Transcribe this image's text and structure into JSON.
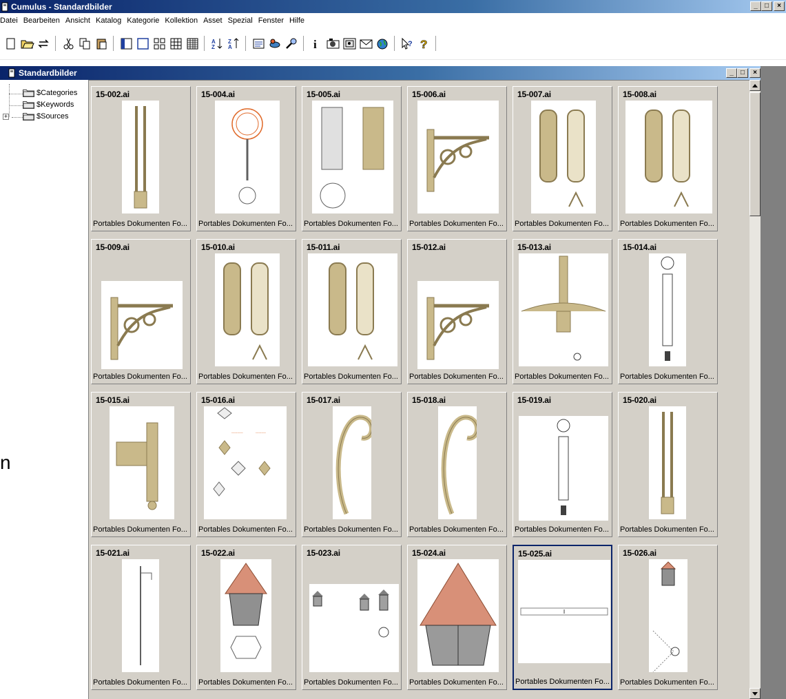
{
  "app": {
    "title": "Cumulus - Standardbilder",
    "window_buttons": [
      "_",
      "□",
      "×"
    ]
  },
  "menu": [
    "Datei",
    "Bearbeiten",
    "Ansicht",
    "Katalog",
    "Kategorie",
    "Kollektion",
    "Asset",
    "Spezial",
    "Fenster",
    "Hilfe"
  ],
  "toolbar": {
    "buttons": [
      "new-icon",
      "open-folder-icon",
      "swap-icon",
      "cut-icon",
      "copy-icon",
      "paste-icon",
      "preview-pane-icon",
      "single-view-icon",
      "thumb-view-icon",
      "small-thumb-view-icon",
      "list-view-icon",
      "sort-asc-icon",
      "sort-desc-icon",
      "record-view-icon",
      "connect-icon",
      "find-icon",
      "info-icon",
      "camera-icon",
      "preview-icon",
      "mail-icon",
      "web-icon",
      "context-help-icon",
      "help-icon"
    ]
  },
  "catalog_window": {
    "title": "Standardbilder",
    "window_buttons": [
      "_",
      "□",
      "×"
    ]
  },
  "tree": {
    "items": [
      {
        "label": "$Categories",
        "expandable": false
      },
      {
        "label": "$Keywords",
        "expandable": false
      },
      {
        "label": "$Sources",
        "expandable": true,
        "expander": "+"
      }
    ]
  },
  "assets": [
    {
      "name": "15-002.ai",
      "caption": "Portables Dokumenten Fo...",
      "thumb": "tall-pole-icon"
    },
    {
      "name": "15-004.ai",
      "caption": "Portables Dokumenten Fo...",
      "thumb": "lamp-drawing-icon"
    },
    {
      "name": "15-005.ai",
      "caption": "Portables Dokumenten Fo...",
      "thumb": "column-drawing-icon"
    },
    {
      "name": "15-006.ai",
      "caption": "Portables Dokumenten Fo...",
      "thumb": "ornate-bracket-icon"
    },
    {
      "name": "15-007.ai",
      "caption": "Portables Dokumenten Fo...",
      "thumb": "wall-plate-icon"
    },
    {
      "name": "15-008.ai",
      "caption": "Portables Dokumenten Fo...",
      "thumb": "wall-plate-icon"
    },
    {
      "name": "15-009.ai",
      "caption": "Portables Dokumenten Fo...",
      "thumb": "ornate-bracket-icon"
    },
    {
      "name": "15-010.ai",
      "caption": "Portables Dokumenten Fo...",
      "thumb": "wall-plate-icon"
    },
    {
      "name": "15-011.ai",
      "caption": "Portables Dokumenten Fo...",
      "thumb": "wall-plate-icon"
    },
    {
      "name": "15-012.ai",
      "caption": "Portables Dokumenten Fo...",
      "thumb": "ornate-bracket-icon"
    },
    {
      "name": "15-013.ai",
      "caption": "Portables Dokumenten Fo...",
      "thumb": "chandelier-icon"
    },
    {
      "name": "15-014.ai",
      "caption": "Portables Dokumenten Fo...",
      "thumb": "technical-drawing-icon"
    },
    {
      "name": "15-015.ai",
      "caption": "Portables Dokumenten Fo...",
      "thumb": "side-bracket-icon"
    },
    {
      "name": "15-016.ai",
      "caption": "Portables Dokumenten Fo...",
      "thumb": "parts-sheet-icon"
    },
    {
      "name": "15-017.ai",
      "caption": "Portables Dokumenten Fo...",
      "thumb": "hook-arm-icon"
    },
    {
      "name": "15-018.ai",
      "caption": "Portables Dokumenten Fo...",
      "thumb": "hook-arm-icon"
    },
    {
      "name": "15-019.ai",
      "caption": "Portables Dokumenten Fo...",
      "thumb": "technical-drawing-icon"
    },
    {
      "name": "15-020.ai",
      "caption": "Portables Dokumenten Fo...",
      "thumb": "tall-pole-icon"
    },
    {
      "name": "15-021.ai",
      "caption": "Portables Dokumenten Fo...",
      "thumb": "thin-pole-icon"
    },
    {
      "name": "15-022.ai",
      "caption": "Portables Dokumenten Fo...",
      "thumb": "lantern-icon"
    },
    {
      "name": "15-023.ai",
      "caption": "Portables Dokumenten Fo...",
      "thumb": "small-lanterns-icon"
    },
    {
      "name": "15-024.ai",
      "caption": "Portables Dokumenten Fo...",
      "thumb": "large-lantern-icon"
    },
    {
      "name": "15-025.ai",
      "caption": "Portables Dokumenten Fo...",
      "thumb": "blank-line-icon",
      "selected": true
    },
    {
      "name": "15-026.ai",
      "caption": "Portables Dokumenten Fo...",
      "thumb": "lantern-detail-icon"
    }
  ],
  "stray_text": "n",
  "colors": {
    "title_gradient_start": "#0a246a",
    "title_gradient_end": "#a6caf0",
    "face": "#d4d0c8",
    "brass": "#c9b98a",
    "lamp_orange": "#e06a2a",
    "roof_salmon": "#d89078"
  }
}
